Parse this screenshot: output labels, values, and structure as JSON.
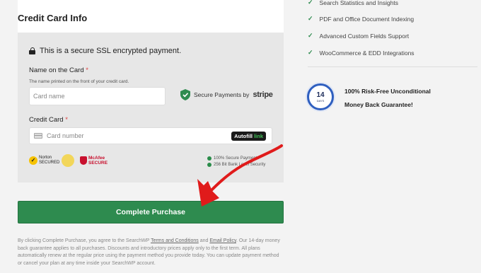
{
  "card_info": {
    "title": "Credit Card Info",
    "secure_text": "This is a secure SSL encrypted payment.",
    "name_label": "Name on the Card",
    "required_mark": "*",
    "name_hint": "The name printed on the front of your credit card.",
    "name_placeholder": "Card name",
    "secure_payments_text": "Secure Payments by",
    "stripe_logo": "stripe",
    "cc_label": "Credit Card",
    "cc_placeholder": "Card number",
    "autofill_text": "Autofill",
    "autofill_link": "link",
    "mini_line1": "100% Secure Payments",
    "mini_line2": "256 Bit Bank Level Security",
    "norton_text": "Norton SECURED",
    "mcafee_text": "McAfee SECURE"
  },
  "purchase": {
    "button_label": "Complete Purchase",
    "terms_text_1": "By clicking Complete Purchase, you agree to the SearchWP ",
    "terms_link": "Terms and Conditions",
    "terms_and": " and ",
    "privacy_link": "Email Policy",
    "terms_text_2": ". Our 14-day money back guarantee applies to all purchases. Discounts and introductory prices apply only to the first term. All plans automatically renew at the regular price using the payment method you provide today. You can update payment method or cancel your plan at any time inside your SearchWP account."
  },
  "features": [
    "Search Statistics and Insights",
    "PDF and Office Document Indexing",
    "Advanced Custom Fields Support",
    "WooCommerce & EDD Integrations"
  ],
  "guarantee": {
    "badge_number": "14",
    "badge_days": "DAYS",
    "line1": "100% Risk-Free Unconditional",
    "line2": "Money Back Guarantee!"
  },
  "colors": {
    "accent_green": "#2e8b4f",
    "annotation_red": "#e01b1b",
    "badge_blue": "#2f5fbf"
  }
}
